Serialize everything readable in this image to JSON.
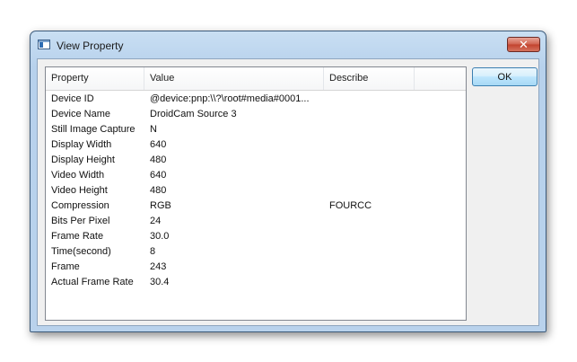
{
  "window": {
    "title": "View Property",
    "close_glyph": "✕"
  },
  "buttons": {
    "ok_label": "OK"
  },
  "table": {
    "columns": [
      "Property",
      "Value",
      "Describe"
    ],
    "rows": [
      {
        "property": "Device ID",
        "value": "@device:pnp:\\\\?\\root#media#0001...",
        "describe": ""
      },
      {
        "property": "Device Name",
        "value": "DroidCam Source 3",
        "describe": ""
      },
      {
        "property": "Still Image Capture",
        "value": "N",
        "describe": ""
      },
      {
        "property": "Display Width",
        "value": "640",
        "describe": ""
      },
      {
        "property": "Display Height",
        "value": "480",
        "describe": ""
      },
      {
        "property": "Video Width",
        "value": "640",
        "describe": ""
      },
      {
        "property": "Video Height",
        "value": "480",
        "describe": ""
      },
      {
        "property": "Compression",
        "value": "RGB",
        "describe": "FOURCC"
      },
      {
        "property": "Bits Per Pixel",
        "value": "24",
        "describe": ""
      },
      {
        "property": "Frame Rate",
        "value": "30.0",
        "describe": ""
      },
      {
        "property": "Time(second)",
        "value": "8",
        "describe": ""
      },
      {
        "property": "Frame",
        "value": "243",
        "describe": ""
      },
      {
        "property": "Actual Frame Rate",
        "value": "30.4",
        "describe": ""
      }
    ]
  },
  "icons": {
    "app": "window-app-icon",
    "close": "close-icon"
  }
}
